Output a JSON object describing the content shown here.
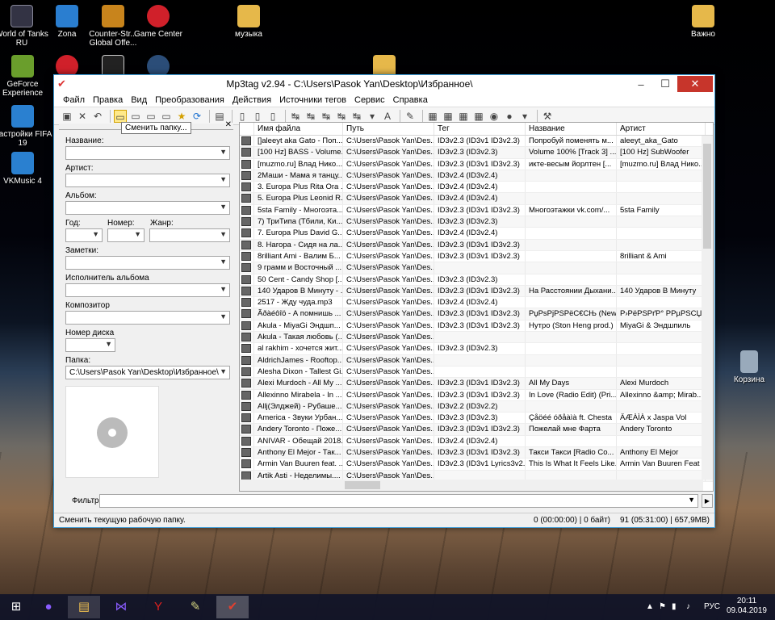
{
  "desktop": {
    "icons": [
      {
        "label": "World of Tanks RU",
        "color": "#334"
      },
      {
        "label": "Zona",
        "color": "#2a7ed0"
      },
      {
        "label": "Counter-Str... Global Offe...",
        "color": "#c8841c"
      },
      {
        "label": "Game Center",
        "color": "#d0202a"
      },
      {
        "label": "музыка",
        "color": "#e6b84a"
      },
      {
        "label": "Важно",
        "color": "#e6b84a"
      },
      {
        "label": "GeForce Experience",
        "color": "#6a9e2c"
      },
      {
        "label": "Настройки FIFA 19",
        "color": "#2a80d0"
      },
      {
        "label": "VKMusic 4",
        "color": "#2a80d0"
      },
      {
        "label": "Корзина",
        "color": "#9ab"
      }
    ]
  },
  "window": {
    "title": "Mp3tag v2.94  -  C:\\Users\\Pasok Yan\\Desktop\\Избранное\\"
  },
  "menu": [
    "Файл",
    "Правка",
    "Вид",
    "Преобразования",
    "Действия",
    "Источники тегов",
    "Сервис",
    "Справка"
  ],
  "tooltip": "Сменить папку...",
  "left": {
    "title_label": "Название:",
    "artist_label": "Артист:",
    "album_label": "Альбом:",
    "year_label": "Год:",
    "track_label": "Номер:",
    "genre_label": "Жанр:",
    "comment_label": "Заметки:",
    "album_artist_label": "Исполнитель альбома",
    "composer_label": "Композитор",
    "disc_label": "Номер диска",
    "folder_label": "Папка:",
    "folder_value": "C:\\Users\\Pasok Yan\\Desktop\\Избранное\\"
  },
  "columns": [
    "Имя файла",
    "Путь",
    "Тег",
    "Название",
    "Артист"
  ],
  "rows": [
    [
      "[]aleeyt aka Gato - Поп...",
      "C:\\Users\\Pasok Yan\\Des...",
      "ID3v2.3 (ID3v1 ID3v2.3)",
      "Попробуй поменять м...",
      "aleeyt_aka_Gato"
    ],
    [
      "[100 Hz] BASS - Volume...",
      "C:\\Users\\Pasok Yan\\Des...",
      "ID3v2.3 (ID3v2.3)",
      "Volume 100% [Track 3] ...",
      "[100 Hz] SubWoofer"
    ],
    [
      "[muzmo.ru] Влад Нико...",
      "C:\\Users\\Pasok Yan\\Des...",
      "ID3v2.3 (ID3v1 ID3v2.3)",
      "икте-весым йорлтен [...",
      "[muzmo.ru] Влад Нико..."
    ],
    [
      "2Маши - Мама я танцу...",
      "C:\\Users\\Pasok Yan\\Des...",
      "ID3v2.4 (ID3v2.4)",
      "",
      ""
    ],
    [
      "3. Europa Plus  Rita Ora ...",
      "C:\\Users\\Pasok Yan\\Des...",
      "ID3v2.4 (ID3v2.4)",
      "",
      ""
    ],
    [
      "5. Europa Plus  Leonid R...",
      "C:\\Users\\Pasok Yan\\Des...",
      "ID3v2.4 (ID3v2.4)",
      "",
      ""
    ],
    [
      "5sta Family - Многоэта...",
      "C:\\Users\\Pasok Yan\\Des...",
      "ID3v2.3 (ID3v1 ID3v2.3)",
      "Многоэтажки vk.com/...",
      "5sta Family"
    ],
    [
      "7) ТриТипа (Тбили, Ки...",
      "C:\\Users\\Pasok Yan\\Des...",
      "ID3v2.3 (ID3v2.3)",
      "",
      ""
    ],
    [
      "7. Europa Plus  David G...",
      "C:\\Users\\Pasok Yan\\Des...",
      "ID3v2.4 (ID3v2.4)",
      "",
      ""
    ],
    [
      "8. Нагора - Сидя на ла...",
      "C:\\Users\\Pasok Yan\\Des...",
      "ID3v2.3 (ID3v1 ID3v2.3)",
      "",
      ""
    ],
    [
      "8rilliant  Ami - Валим Б...",
      "C:\\Users\\Pasok Yan\\Des...",
      "ID3v2.3 (ID3v1 ID3v2.3)",
      "",
      "8rilliant & Ami"
    ],
    [
      "9 грамм и Восточный ...",
      "C:\\Users\\Pasok Yan\\Des...",
      "",
      "",
      ""
    ],
    [
      "50 Cent - Candy Shop [...",
      "C:\\Users\\Pasok Yan\\Des...",
      "ID3v2.3 (ID3v2.3)",
      "",
      ""
    ],
    [
      "140 Ударов В Минуту - ...",
      "C:\\Users\\Pasok Yan\\Des...",
      "ID3v2.3 (ID3v1 ID3v2.3)",
      "На Расстоянии Дыхани...",
      "140 Ударов В Минуту"
    ],
    [
      "2517 - Жду чуда.mp3",
      "C:\\Users\\Pasok Yan\\Des...",
      "ID3v2.4 (ID3v2.4)",
      "",
      ""
    ],
    [
      "Ãðàéôîö - А помнишь ...",
      "C:\\Users\\Pasok Yan\\Des...",
      "ID3v2.3 (ID3v1 ID3v2.3)",
      "РџРѕРјРЅРёС€СЊ (New...",
      "Р›РёРЅРґР° РРµРЅСЏ..."
    ],
    [
      "Akula - MiyaGi  Эндшп...",
      "C:\\Users\\Pasok Yan\\Des...",
      "ID3v2.3 (ID3v1 ID3v2.3)",
      "Нутро (Ston Heng prod.)",
      "MiyaGi & Эндшпиль"
    ],
    [
      "Akula - Такая любовь (...",
      "C:\\Users\\Pasok Yan\\Des...",
      "",
      "",
      ""
    ],
    [
      "al rakhim - хочется жит...",
      "C:\\Users\\Pasok Yan\\Des...",
      "ID3v2.3 (ID3v2.3)",
      "",
      ""
    ],
    [
      "AldrichJames - Rooftop...",
      "C:\\Users\\Pasok Yan\\Des...",
      "",
      "",
      ""
    ],
    [
      "Alesha Dixon - Tallest Gi...",
      "C:\\Users\\Pasok Yan\\Des...",
      "",
      "",
      ""
    ],
    [
      "Alexi Murdoch - All My ...",
      "C:\\Users\\Pasok Yan\\Des...",
      "ID3v2.3 (ID3v1 ID3v2.3)",
      "All My Days",
      "Alexi Murdoch"
    ],
    [
      "Allexinno  Mirabela - In ...",
      "C:\\Users\\Pasok Yan\\Des...",
      "ID3v2.3 (ID3v1 ID3v2.3)",
      "In Love (Radio Edit) (Pri...",
      "Allexinno &amp; Mirab..."
    ],
    [
      "Allj(Элджей) - Рубаше...",
      "C:\\Users\\Pasok Yan\\Des...",
      "ID3v2.2 (ID3v2.2)",
      "",
      ""
    ],
    [
      "America - Звуки Урбан...",
      "C:\\Users\\Pasok Yan\\Des...",
      "ID3v2.3 (ID3v2.3)",
      "Çåöéé óðåàìà ft. Chesta",
      "ÄÆÀÌÀ x Jaspa Vol"
    ],
    [
      "Andery Toronto - Поже...",
      "C:\\Users\\Pasok Yan\\Des...",
      "ID3v2.3 (ID3v1 ID3v2.3)",
      "Пожелай мне Фарта",
      "Andery Toronto"
    ],
    [
      "ANIVAR - Обещай 2018...",
      "C:\\Users\\Pasok Yan\\Des...",
      "ID3v2.4 (ID3v2.4)",
      "",
      ""
    ],
    [
      "Anthony El Mejor - Так...",
      "C:\\Users\\Pasok Yan\\Des...",
      "ID3v2.3 (ID3v1 ID3v2.3)",
      "Такси Такси [Radio Co...",
      "Anthony El Mejor"
    ],
    [
      "Armin Van Buuren feat. ...",
      "C:\\Users\\Pasok Yan\\Des...",
      "ID3v2.3 (ID3v1 Lyrics3v2...",
      "This Is What It Feels Like...",
      "Armin Van Buuren Feat ..."
    ],
    [
      "Artik  Asti - Неделимы....",
      "C:\\Users\\Pasok Yan\\Des...",
      "",
      "",
      ""
    ]
  ],
  "filter": {
    "label": "Фильтр:"
  },
  "status": {
    "left": "Сменить текущую рабочую папку.",
    "sel": "0 (00:00:00) | 0 байт)",
    "total": "91 (05:31:00) | 657,9MB)"
  },
  "taskbar": {
    "lang": "РУС",
    "time": "20:11",
    "date": "09.04.2019"
  }
}
